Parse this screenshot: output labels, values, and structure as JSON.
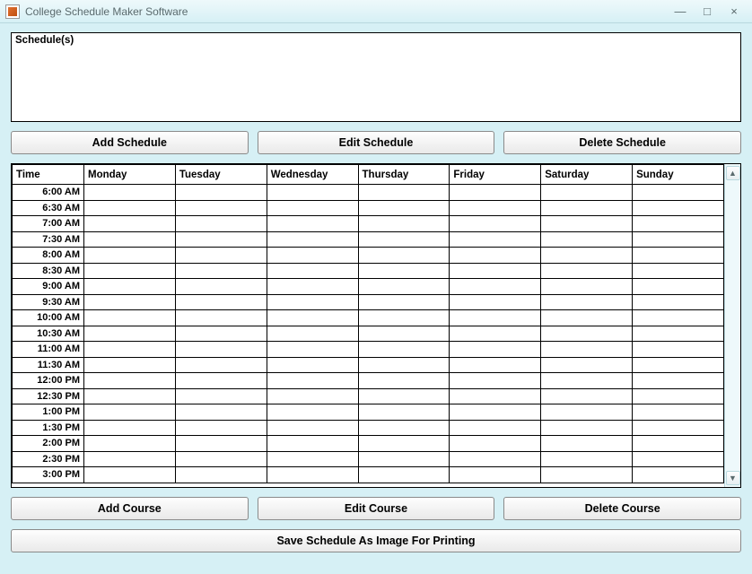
{
  "window": {
    "title": "College Schedule Maker Software",
    "minimize": "—",
    "maximize": "□",
    "close": "×"
  },
  "schedules": {
    "label": "Schedule(s)"
  },
  "buttons": {
    "add_schedule": "Add Schedule",
    "edit_schedule": "Edit Schedule",
    "delete_schedule": "Delete Schedule",
    "add_course": "Add Course",
    "edit_course": "Edit Course",
    "delete_course": "Delete Course",
    "save_image": "Save Schedule As Image For Printing"
  },
  "table": {
    "headers": [
      "Time",
      "Monday",
      "Tuesday",
      "Wednesday",
      "Thursday",
      "Friday",
      "Saturday",
      "Sunday"
    ],
    "times": [
      "6:00 AM",
      "6:30 AM",
      "7:00 AM",
      "7:30 AM",
      "8:00 AM",
      "8:30 AM",
      "9:00 AM",
      "9:30 AM",
      "10:00 AM",
      "10:30 AM",
      "11:00 AM",
      "11:30 AM",
      "12:00 PM",
      "12:30 PM",
      "1:00 PM",
      "1:30 PM",
      "2:00 PM",
      "2:30 PM",
      "3:00 PM"
    ]
  },
  "scrollbar": {
    "up": "▲",
    "down": "▼"
  }
}
